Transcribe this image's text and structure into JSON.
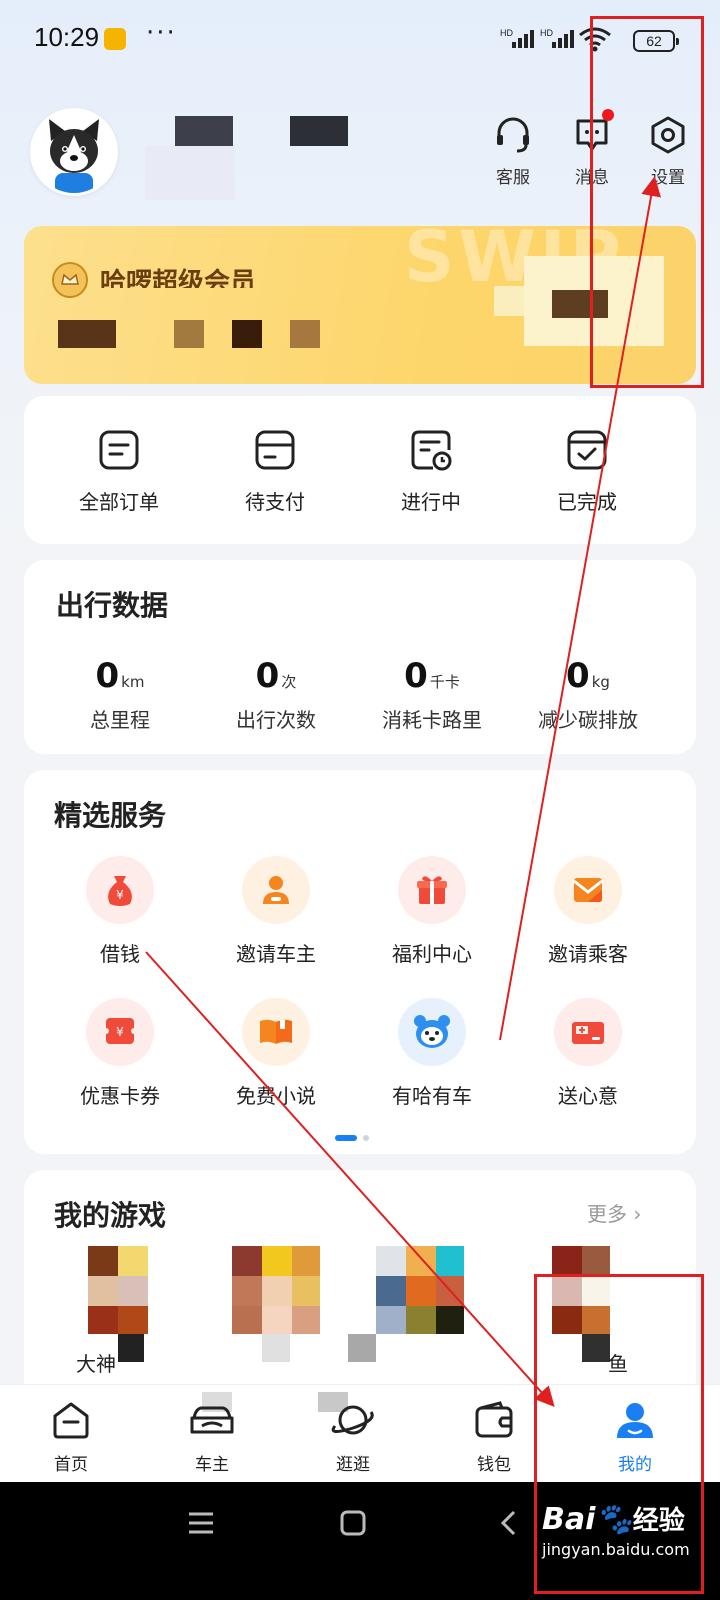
{
  "status_bar": {
    "time": "10:29",
    "dots": "···",
    "hd1": "HD",
    "hd2": "HD",
    "battery": "62"
  },
  "header": {
    "actions": [
      {
        "label": "客服",
        "icon": "headset-icon"
      },
      {
        "label": "消息",
        "icon": "message-icon"
      },
      {
        "label": "设置",
        "icon": "settings-icon"
      }
    ]
  },
  "member_card": {
    "title": "哈啰超级会员",
    "watermark": "SWIP"
  },
  "orders": [
    {
      "label": "全部订单"
    },
    {
      "label": "待支付"
    },
    {
      "label": "进行中"
    },
    {
      "label": "已完成"
    }
  ],
  "travel_data": {
    "title": "出行数据",
    "stats": [
      {
        "value": "0",
        "unit": "km",
        "label": "总里程"
      },
      {
        "value": "0",
        "unit": "次",
        "label": "出行次数"
      },
      {
        "value": "0",
        "unit": "千卡",
        "label": "消耗卡路里"
      },
      {
        "value": "0",
        "unit": "kg",
        "label": "减少碳排放"
      }
    ]
  },
  "services": {
    "title": "精选服务",
    "items": [
      {
        "label": "借钱",
        "icon": "money-bag-icon"
      },
      {
        "label": "邀请车主",
        "icon": "invite-driver-icon"
      },
      {
        "label": "福利中心",
        "icon": "gift-icon"
      },
      {
        "label": "邀请乘客",
        "icon": "envelope-icon"
      },
      {
        "label": "优惠卡券",
        "icon": "coupon-icon"
      },
      {
        "label": "免费小说",
        "icon": "book-icon"
      },
      {
        "label": "有哈有车",
        "icon": "mascot-icon"
      },
      {
        "label": "送心意",
        "icon": "gift-card-icon"
      }
    ]
  },
  "games": {
    "title": "我的游戏",
    "more": "更多",
    "items": [
      {
        "label": "大神"
      },
      {
        "label": ""
      },
      {
        "label": ""
      },
      {
        "label": "鱼"
      }
    ]
  },
  "tabbar": {
    "items": [
      {
        "label": "首页",
        "icon": "home-icon",
        "active": false
      },
      {
        "label": "车主",
        "icon": "car-icon",
        "active": false
      },
      {
        "label": "逛逛",
        "icon": "planet-icon",
        "active": false
      },
      {
        "label": "钱包",
        "icon": "wallet-icon",
        "active": false
      },
      {
        "label": "我的",
        "icon": "profile-icon",
        "active": true
      }
    ]
  },
  "watermark": {
    "brand": "Bai",
    "brand2": "经验",
    "url": "jingyan.baidu.com"
  },
  "colors": {
    "accent": "#1a7ff2",
    "annotation": "#e02020",
    "member_gold": "#fdd66b"
  }
}
